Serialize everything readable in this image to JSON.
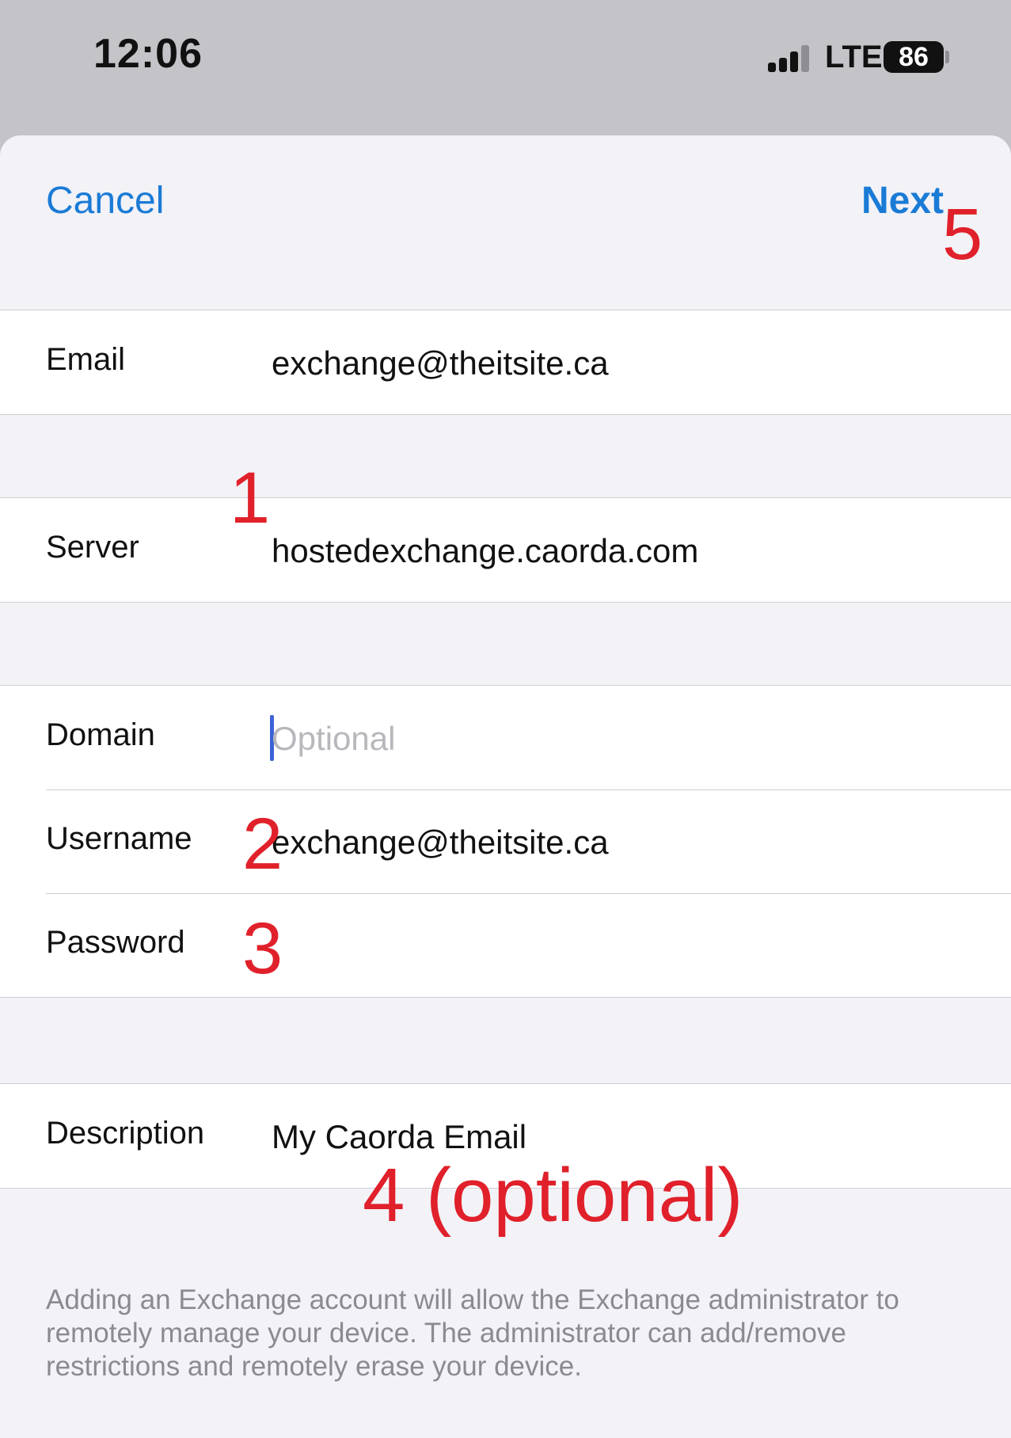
{
  "status_bar": {
    "time": "12:06",
    "network": "LTE",
    "battery": "86"
  },
  "nav": {
    "cancel": "Cancel",
    "next": "Next"
  },
  "fields": {
    "email": {
      "label": "Email",
      "value": "exchange@theitsite.ca"
    },
    "server": {
      "label": "Server",
      "value": "hostedexchange.caorda.com"
    },
    "domain": {
      "label": "Domain",
      "placeholder": "Optional"
    },
    "username": {
      "label": "Username",
      "value": "exchange@theitsite.ca"
    },
    "password": {
      "label": "Password",
      "value": ""
    },
    "description": {
      "label": "Description",
      "value": "My Caorda Email"
    }
  },
  "footer_text": "Adding an Exchange account will allow the Exchange administrator to remotely manage your device. The administrator can add/remove restrictions and remotely erase your device.",
  "annotations": {
    "a1": "1",
    "a2": "2",
    "a3": "3",
    "a4": "4 (optional)",
    "a5": "5"
  },
  "colors": {
    "accent": "#1a7bd6",
    "annotation": "#e0202a",
    "caret": "#3d63d8",
    "background": "#f2f2f7"
  },
  "icons": [
    "cellular-signal-icon",
    "battery-icon"
  ]
}
